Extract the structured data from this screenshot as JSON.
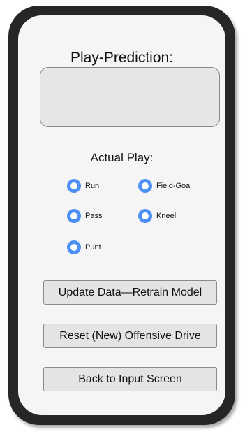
{
  "title": "Play-Prediction:",
  "prediction_value": "",
  "actual_play": {
    "label": "Actual Play:",
    "options": [
      {
        "label": "Run"
      },
      {
        "label": "Field-Goal"
      },
      {
        "label": "Pass"
      },
      {
        "label": "Kneel"
      },
      {
        "label": "Punt"
      }
    ]
  },
  "buttons": {
    "update_label": "Update Data—Retrain Model",
    "reset_label": "Reset (New) Offensive Drive",
    "back_label": "Back to Input Screen"
  },
  "colors": {
    "accent": "#4d8ff3",
    "frame": "#262626",
    "screen": "#f5f5f5"
  }
}
